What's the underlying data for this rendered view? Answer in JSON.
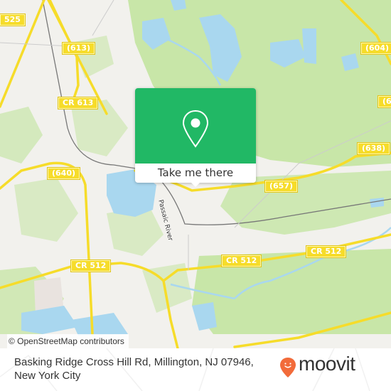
{
  "map": {
    "colors": {
      "land": "#f2f1ed",
      "forest": "#c8e6a8",
      "water": "#a9d7ef",
      "road": "#f6dc2a",
      "rail": "#777777",
      "popup_green": "#21b865"
    },
    "road_labels": [
      {
        "id": "cr525",
        "text": "525"
      },
      {
        "id": "r613",
        "text": "(613)"
      },
      {
        "id": "cr613",
        "text": "CR 613"
      },
      {
        "id": "r604",
        "text": "(604)"
      },
      {
        "id": "r60x",
        "text": "(60"
      },
      {
        "id": "r638",
        "text": "(638)"
      },
      {
        "id": "r640",
        "text": "(640)"
      },
      {
        "id": "r657",
        "text": "(657)"
      },
      {
        "id": "cr512a",
        "text": "CR 512"
      },
      {
        "id": "cr512b",
        "text": "CR 512"
      },
      {
        "id": "cr512c",
        "text": "CR 512"
      }
    ],
    "water_labels": [
      {
        "id": "passaic",
        "text": "Passaic River"
      }
    ],
    "attribution": "© OpenStreetMap contributors"
  },
  "popup": {
    "icon": "map-pin-icon",
    "action_label": "Take me there"
  },
  "footer": {
    "address_line1": "Basking Ridge Cross Hill Rd, Millington, NJ 07946,",
    "address_line2": "New York City",
    "brand": "moovit",
    "brand_color": "#f26b3a"
  }
}
